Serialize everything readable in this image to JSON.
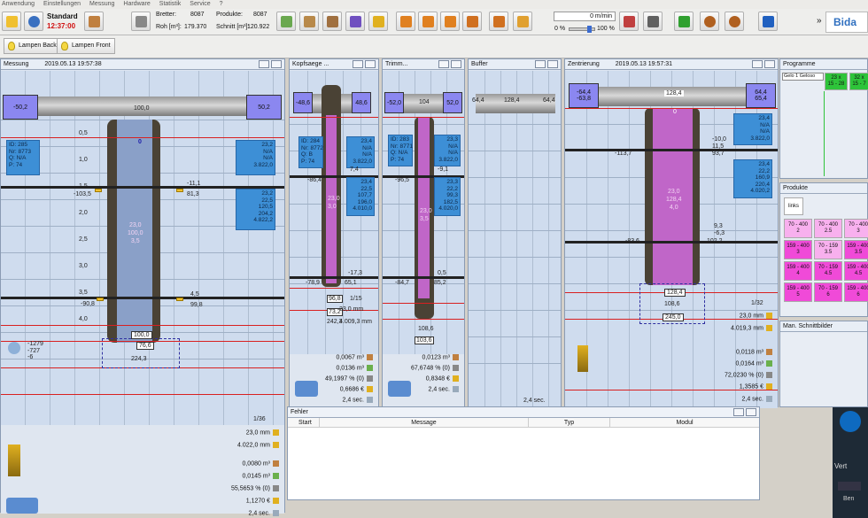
{
  "menu": [
    "Anwendung",
    "Einstellungen",
    "Messung",
    "Hardware",
    "Statistik",
    "Service",
    "?"
  ],
  "header": {
    "mode": "Standard",
    "time": "12:37:00",
    "bretter_label": "Bretter:",
    "bretter_value": "8087",
    "produkte_label": "Produkte:",
    "produkte_value": "8087",
    "roh_label": "Roh [m³]:",
    "roh_value": "179.370",
    "schnitt_label": "Schnitt [m³]:",
    "schnitt_value": "120.922",
    "speed": "0 m/min",
    "pct_left": "0 %",
    "pct_right": "100 %",
    "more": "»",
    "brand": "Bida"
  },
  "lamps": {
    "back": "Lampen Back",
    "front": "Lampen Front"
  },
  "messung": {
    "title": "Messung",
    "timestamp": "2019.05.13 19:57:38",
    "pipe_left": "-50,2",
    "pipe_right": "50,2",
    "top_val": "100,0",
    "zero": "0",
    "info_left": "ID: 285\nNr: 8773\nQ: N/A\nP: 74",
    "info_right1": "23,2\nN/A\nN/A\n3.822,0",
    "info_right2": "23,2\n22,5\n120,5\n204,2\n4.822,2",
    "center": "23,0\n100,0\n3,5",
    "scale": [
      "0,5",
      "1,0",
      "1,5",
      "2,0",
      "2,5",
      "3,0",
      "3,5",
      "4,0"
    ],
    "l15": "-103,5",
    "r15a": "-11,1",
    "r15b": "81,3",
    "l35": "-90,8",
    "r35a": "4,5",
    "r35b": "99,8",
    "b1": "100,0",
    "b2": "76,6",
    "b3": "224,3",
    "side1": "-1279",
    "side2": "-727",
    "side3": "-6",
    "counter": "1/36",
    "s1": "23,0 mm",
    "s2": "4.022,0 mm",
    "s3": "0,0080 m³",
    "s4": "0,0145 m³",
    "s5": "55,5653 % (0)",
    "s6": "1,1270 €",
    "s7": "2,4 sec."
  },
  "kopf": {
    "title": "Kopfsaege ...",
    "pl": "-48,6",
    "pr": "48,6",
    "info_l": "ID: 284\nNr: 8772\nQ: B\nP: 74",
    "info_r": "23,4\nN/A\nN/A\n3.822,0",
    "v74": "7,4",
    "vm864": "-86,4",
    "vm": "101,2",
    "info2": "23,4\n22,5\n107,7\n196,0\n4.010,0",
    "center": "23,0\n3,0",
    "v173": "-17,3",
    "vm789": "-78,9",
    "v651": "65,1",
    "b1": "96,8",
    "b2": "73,2",
    "b3": "242,3",
    "counter": "1/15",
    "s1": "23,0 mm",
    "s2": "4.009,3 mm",
    "s3": "0,0067 m³",
    "s4": "0,0136 m³",
    "s5": "49,1997 % (0)",
    "s6": "0,6686 €",
    "s7": "2,4 sec."
  },
  "trimm": {
    "title": "Trimm...",
    "pl": "-52,0",
    "pr": "52,0",
    "t1": "104",
    "info_l": "ID: 283\nNr: 8771\nQ: N/A\nP: 74",
    "info_r": "23,3\nN/A\nN/A\n3.822,0",
    "v91": "-9,1",
    "vm965": "-96,5",
    "info2": "23,3\n22,2\n99,3\n182,5\n4.020,0",
    "center": "23,0\n3,5",
    "v05": "0,5",
    "vm847": "-84,7",
    "v852": "85,2",
    "b1": "108,6",
    "b2": "103,6",
    "s3": "0,0123 m³",
    "s5": "67,6748 % (0)",
    "s6": "0,8348 €",
    "s7": "2,4 sec."
  },
  "buffer": {
    "title": "Buffer",
    "pl": "64,4",
    "mid": "128,4",
    "pr": "64,4",
    "s7": "2,4 sec."
  },
  "zentrierung": {
    "title": "Zentrierung",
    "timestamp": "2019.05.13 19:57:31",
    "pl": "-64,4\n-63,8",
    "pr": "64,4\n65,4",
    "top": "128,4",
    "zero": "0",
    "info_r1": "23,4\nN/A\nN/A\n3.822,0",
    "v100": "-10,0",
    "v115": "11,5",
    "vm1137": "-113,7",
    "v937": "93,7",
    "info_r2": "23,4\n22,2\n160,9\n220,4\n4.020,2",
    "center": "23,0\n128,4\n4,0",
    "v93": "9,3",
    "v63": "-6,3",
    "vm836": "-83,6",
    "v1022": "102,2",
    "b1": "128,4",
    "b2": "108,6",
    "b3": "245,0",
    "counter": "1/32",
    "s1": "23,0 mm",
    "s2": "4.019,3 mm",
    "s3": "0,0118 m³",
    "s4": "0,0164 m³",
    "s5": "72,0230 % (0)",
    "s6": "1,3585 €",
    "s7": "2,4 sec."
  },
  "fehler": {
    "title": "Fehler",
    "cols": [
      "Start",
      "Message",
      "Typ",
      "Modul"
    ]
  },
  "programme": {
    "title": "Programme",
    "item": "Gelo 1 Geloso",
    "c1": "23 x\n15 - 28",
    "c2": "32 x\n15 - 7"
  },
  "produkte": {
    "title": "Produkte",
    "links": "links",
    "cells": [
      "70 - 400\n2",
      "70 - 400\n2.5",
      "70 - 400\n3",
      "159 - 400\n3",
      "70 - 159\n3.5",
      "159 - 400\n3.5",
      "159 - 400\n4",
      "70 - 159\n4.5",
      "159 - 400\n4.5",
      "159 - 400\n5",
      "70 - 159\n6",
      "159 - 400\n6"
    ]
  },
  "schnittbilder": {
    "title": "Man. Schnittbilder"
  },
  "ver": "Vert",
  "ben": "Ben",
  "colors": {
    "red_line": "#d82020",
    "info_blue": "#3d8fd6",
    "purple": "#8b87f0",
    "magenta": "#f04ad8",
    "pink": "#f8b0ee",
    "green": "#2ec43a"
  }
}
